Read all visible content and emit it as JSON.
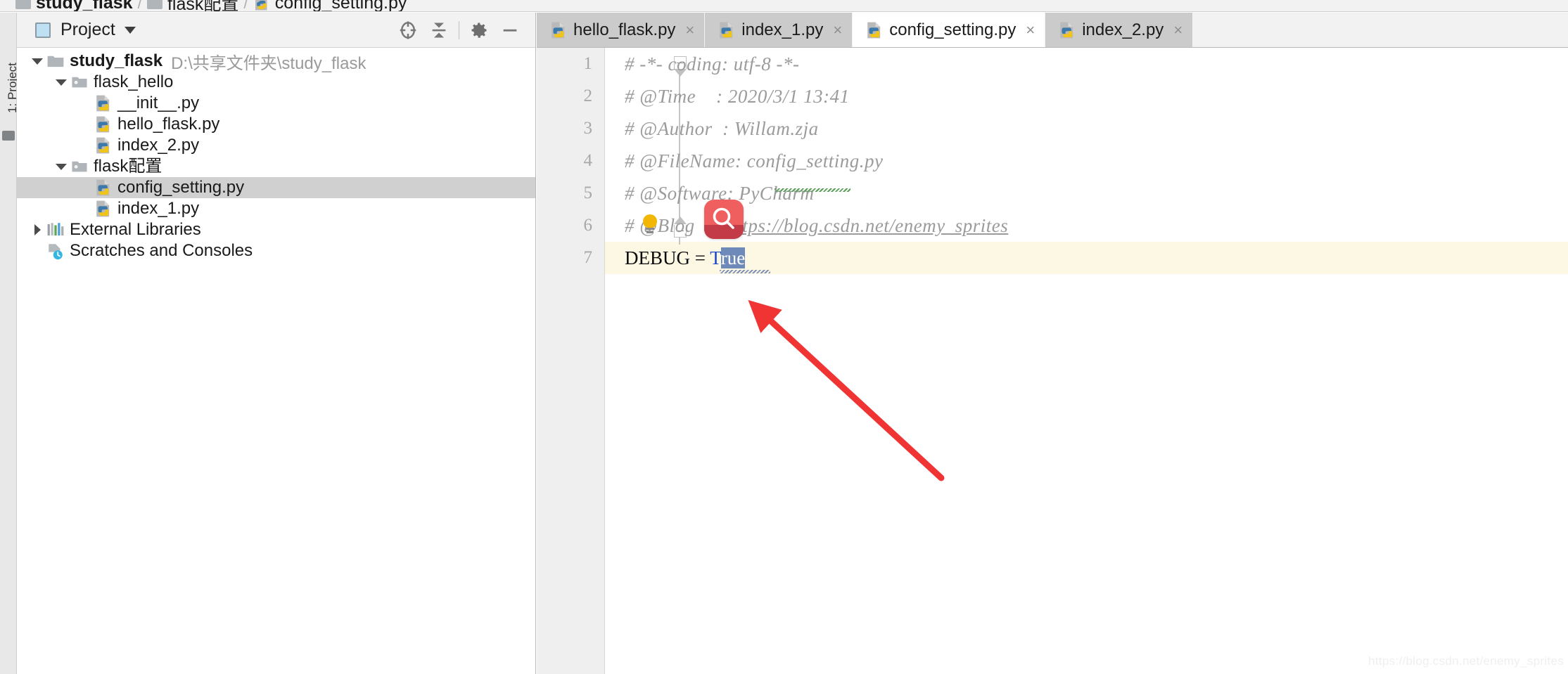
{
  "breadcrumb": {
    "name": "breadcrumb",
    "items": [
      {
        "label": "study_flask",
        "icon": "folder-icon"
      },
      {
        "label": "flask配置",
        "icon": "folder-icon"
      },
      {
        "label": "config_setting.py",
        "icon": "python-file-icon"
      }
    ],
    "separator": "/"
  },
  "tool_strip": {
    "project_tab_label": "1: Project"
  },
  "project_panel": {
    "header": {
      "title": "Project",
      "caret": "chevron-down-icon",
      "buttons": [
        {
          "name": "locate-button",
          "icon": "target-icon"
        },
        {
          "name": "collapse-all-button",
          "icon": "collapse-all-icon"
        },
        {
          "name": "settings-button",
          "icon": "gear-icon"
        },
        {
          "name": "hide-button",
          "icon": "minus-icon"
        }
      ]
    },
    "tree": [
      {
        "label": "study_flask",
        "path": "D:\\共享文件夹\\study_flask",
        "icon": "folder-icon",
        "twisty": "expanded",
        "depth": 0,
        "bold": true,
        "selected": false
      },
      {
        "label": "flask_hello",
        "path": "",
        "icon": "module-folder-icon",
        "twisty": "expanded",
        "depth": 1,
        "bold": false,
        "selected": false
      },
      {
        "label": "__init__.py",
        "path": "",
        "icon": "python-file-icon",
        "twisty": "none",
        "depth": 2,
        "bold": false,
        "selected": false
      },
      {
        "label": "hello_flask.py",
        "path": "",
        "icon": "python-file-icon",
        "twisty": "none",
        "depth": 2,
        "bold": false,
        "selected": false
      },
      {
        "label": "index_2.py",
        "path": "",
        "icon": "python-file-icon",
        "twisty": "none",
        "depth": 2,
        "bold": false,
        "selected": false
      },
      {
        "label": "flask配置",
        "path": "",
        "icon": "module-folder-icon",
        "twisty": "expanded",
        "depth": 1,
        "bold": false,
        "selected": false
      },
      {
        "label": "config_setting.py",
        "path": "",
        "icon": "python-file-icon",
        "twisty": "none",
        "depth": 2,
        "bold": false,
        "selected": true
      },
      {
        "label": "index_1.py",
        "path": "",
        "icon": "python-file-icon",
        "twisty": "none",
        "depth": 2,
        "bold": false,
        "selected": false
      },
      {
        "label": "External Libraries",
        "path": "",
        "icon": "libraries-icon",
        "twisty": "collapsed",
        "depth": 0,
        "bold": false,
        "selected": false
      },
      {
        "label": "Scratches and Consoles",
        "path": "",
        "icon": "scratches-icon",
        "twisty": "none",
        "depth": 0,
        "bold": false,
        "selected": false
      }
    ]
  },
  "editor": {
    "tabs": [
      {
        "label": "hello_flask.py",
        "icon": "python-file-icon",
        "close": "×",
        "active": false
      },
      {
        "label": "index_1.py",
        "icon": "python-file-icon",
        "close": "×",
        "active": false
      },
      {
        "label": "config_setting.py",
        "icon": "python-file-icon",
        "close": "×",
        "active": true
      },
      {
        "label": "index_2.py",
        "icon": "python-file-icon",
        "close": "×",
        "active": false
      }
    ],
    "line_numbers": [
      "1",
      "2",
      "3",
      "4",
      "5",
      "6",
      "7"
    ],
    "current_line": 7,
    "lines": [
      {
        "n": "1",
        "text": "# -*- coding: utf-8 -*-",
        "kind": "comment"
      },
      {
        "n": "2",
        "text": "# @Time    : 2020/3/1 13:41",
        "kind": "comment"
      },
      {
        "n": "3",
        "text": "# @Author  : Willam.zja",
        "kind": "comment"
      },
      {
        "n": "4",
        "text": "# @FileName: config_setting.py",
        "kind": "comment"
      },
      {
        "n": "5",
        "text": "# @Software: PyCharm",
        "kind": "comment"
      },
      {
        "n": "6",
        "text": "# @Blog    : ",
        "kind": "comment-link",
        "link": "https://blog.csdn.net/enemy_sprites"
      },
      {
        "n": "7",
        "text": "DEBUG = True",
        "kind": "code"
      }
    ],
    "code_line7": {
      "identifier": "DEBUG",
      "operator": "=",
      "value_head": "T",
      "value_selected": "rue"
    },
    "intention_bulb": "lightbulb-icon",
    "search_badge": "search-icon"
  },
  "annotation": {
    "arrow": "red-arrow-annotation",
    "color": "#f03434"
  },
  "watermark": {
    "text": "https://blog.csdn.net/enemy_sprites"
  }
}
